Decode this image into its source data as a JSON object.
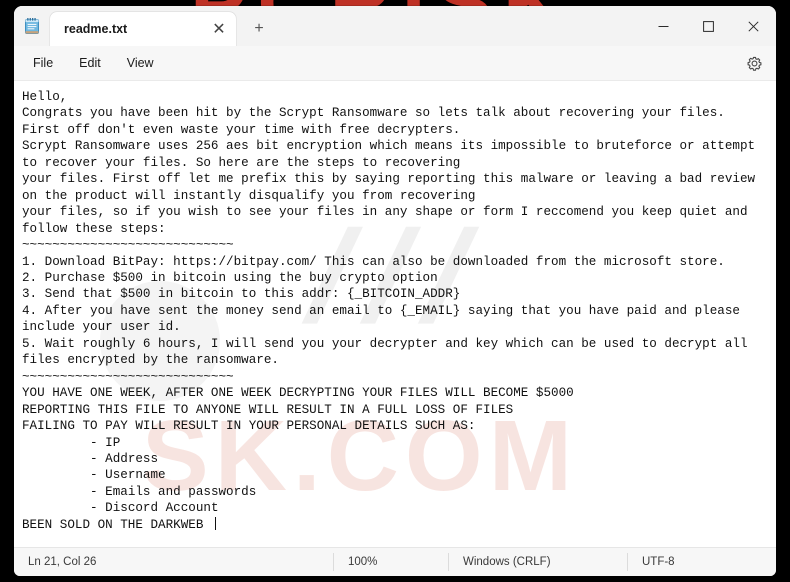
{
  "window": {
    "app_icon": "notepad-icon",
    "tab_label": "readme.txt",
    "tab_close_glyph": "✕",
    "new_tab_glyph": "+",
    "minimize_glyph": "—",
    "maximize_glyph": "□",
    "close_glyph": "✕"
  },
  "menu": {
    "items": [
      {
        "label": "File"
      },
      {
        "label": "Edit"
      },
      {
        "label": "View"
      }
    ],
    "settings_icon": "gear-icon"
  },
  "editor": {
    "text": "Hello,\nCongrats you have been hit by the Scrypt Ransomware so lets talk about recovering your files.\nFirst off don't even waste your time with free decrypters.\nScrypt Ransomware uses 256 aes bit encryption which means its impossible to bruteforce or attempt\nto recover your files. So here are the steps to recovering\nyour files. First off let me prefix this by saying reporting this malware or leaving a bad review\non the product will instantly disqualify you from recovering\nyour files, so if you wish to see your files in any shape or form I reccomend you keep quiet and\nfollow these steps:\n~~~~~~~~~~~~~~~~~~~~~~~~~~~~\n1. Download BitPay: https://bitpay.com/ This can also be downloaded from the microsoft store.\n2. Purchase $500 in bitcoin using the buy crypto option\n3. Send that $500 in bitcoin to this addr: {_BITCOIN_ADDR}\n4. After you have sent the money send an email to {_EMAIL} saying that you have paid and please\ninclude your user id.\n5. Wait roughly 6 hours, I will send you your decrypter and key which can be used to decrypt all\nfiles encrypted by the ransomware.\n~~~~~~~~~~~~~~~~~~~~~~~~~~~~\nYOU HAVE ONE WEEK, AFTER ONE WEEK DECRYPTING YOUR FILES WILL BECOME $5000\nREPORTING THIS FILE TO ANYONE WILL RESULT IN A FULL LOSS OF FILES\nFAILING TO PAY WILL RESULT IN YOUR PERSONAL DETAILS SUCH AS:\n\t - IP\n\t - Address\n\t - Username\n\t - Emails and passwords\n\t - Discord Account\nBEEN SOLD ON THE DARKWEB ",
    "watermark_red": "PCRISK",
    "watermark_pcrisk": "SK.COM",
    "watermark_slash": "///"
  },
  "status_bar": {
    "position": "Ln 21, Col 26",
    "zoom": "100%",
    "line_ending": "Windows (CRLF)",
    "encoding": "UTF-8"
  }
}
